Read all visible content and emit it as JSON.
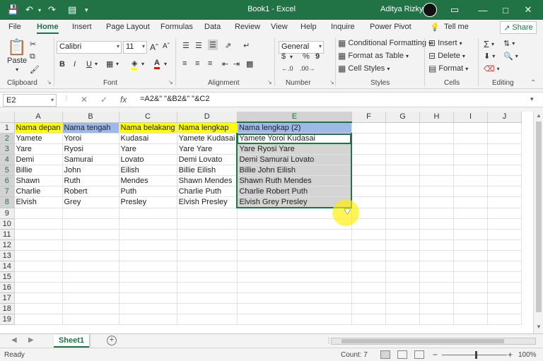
{
  "titlebar": {
    "title": "Book1 - Excel",
    "user": "Aditya Rizky",
    "icons": [
      "save-icon",
      "undo-icon",
      "redo-icon",
      "form-icon",
      "customize-icon"
    ],
    "controls": [
      "ribbon-display-icon",
      "minimize-icon",
      "maximize-icon",
      "close-icon"
    ]
  },
  "ribbon_tabs": [
    "File",
    "Home",
    "Insert",
    "Page Layout",
    "Formulas",
    "Data",
    "Review",
    "View",
    "Help",
    "Inquire",
    "Power Pivot"
  ],
  "active_tab": "Home",
  "tell_me": "Tell me",
  "share_label": "Share",
  "ribbon": {
    "clipboard": {
      "paste_label": "Paste",
      "group_label": "Clipboard"
    },
    "font": {
      "font_name": "Calibri",
      "font_size": "11",
      "bold": "B",
      "italic": "I",
      "underline": "U",
      "group_label": "Font",
      "font_color": "#ff0000",
      "fill_color": "#ffff00"
    },
    "alignment": {
      "group_label": "Alignment"
    },
    "number": {
      "format": "General",
      "dollar": "$",
      "percent": "%",
      "comma": "9",
      "group_label": "Number"
    },
    "styles": {
      "conditional": "Conditional Formatting",
      "format_table": "Format as Table",
      "cell_styles": "Cell Styles",
      "group_label": "Styles"
    },
    "cells": {
      "insert": "Insert",
      "delete": "Delete",
      "format": "Format",
      "group_label": "Cells"
    },
    "editing": {
      "group_label": "Editing"
    }
  },
  "formula_bar": {
    "name_box": "E2",
    "fx": "fx",
    "formula": "=A2&\" \"&B2&\" \"&C2"
  },
  "sheet": {
    "columns": [
      "A",
      "B",
      "C",
      "D",
      "E",
      "F",
      "G",
      "H",
      "I",
      "J"
    ],
    "selected_column": "E",
    "active_cell": "E2",
    "row_numbers": [
      "1",
      "2",
      "3",
      "4",
      "5",
      "6",
      "7",
      "8",
      "9",
      "10",
      "11",
      "12",
      "13",
      "14",
      "15",
      "16",
      "17",
      "18",
      "19"
    ],
    "rows": [
      [
        "Nama depan",
        "Nama tengah",
        "Nama belakang",
        "Nama lengkap",
        "Nama lengkap (2)",
        "",
        "",
        "",
        "",
        ""
      ],
      [
        "Yamete",
        "Yoroi",
        "Kudasai",
        "Yamete Kudasai",
        "Yamete Yoroi Kudasai",
        "",
        "",
        "",
        "",
        ""
      ],
      [
        "Yare",
        "Ryosi",
        "Yare",
        "Yare Yare",
        "Yare Ryosi Yare",
        "",
        "",
        "",
        "",
        ""
      ],
      [
        "Demi",
        "Samurai",
        "Lovato",
        "Demi Lovato",
        "Demi Samurai Lovato",
        "",
        "",
        "",
        "",
        ""
      ],
      [
        "Billie",
        "John",
        "Eilish",
        "Billie Eilish",
        "Billie John Eilish",
        "",
        "",
        "",
        "",
        ""
      ],
      [
        "Shawn",
        "Ruth",
        "Mendes",
        "Shawn Mendes",
        "Shawn Ruth Mendes",
        "",
        "",
        "",
        "",
        ""
      ],
      [
        "Charlie",
        "Robert",
        "Puth",
        "Charlie Puth",
        "Charlie Robert Puth",
        "",
        "",
        "",
        "",
        ""
      ],
      [
        "Elvish",
        "Grey",
        "Presley",
        "Elvish Presley",
        "Elvish Grey Presley",
        "",
        "",
        "",
        "",
        ""
      ]
    ],
    "header_colors": {
      "yellow": "#ffff00",
      "blue": "#9db9e5"
    }
  },
  "sheet_tabs": [
    "Sheet1"
  ],
  "status": {
    "ready": "Ready",
    "count": "Count: 7",
    "zoom": "100%"
  }
}
